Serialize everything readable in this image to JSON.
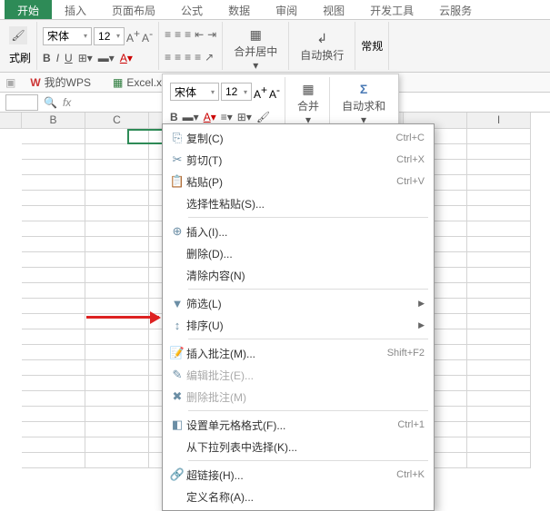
{
  "ribbonTabs": [
    "开始",
    "插入",
    "页面布局",
    "公式",
    "数据",
    "审阅",
    "视图",
    "开发工具",
    "云服务"
  ],
  "formatBrush": "式刷",
  "font": {
    "name": "宋体",
    "size": "12"
  },
  "merge": "合并居中",
  "wrap": "自动换行",
  "normal": "常规",
  "docTabs": {
    "wps": "我的WPS",
    "xls": "Excel.xls *"
  },
  "floatBar": {
    "font": "宋体",
    "size": "12",
    "merge": "合并",
    "sum": "自动求和"
  },
  "cols": [
    "B",
    "C",
    "",
    "",
    "",
    "",
    "",
    "I"
  ],
  "ctx": {
    "copy": {
      "l": "复制(C)",
      "s": "Ctrl+C"
    },
    "cut": {
      "l": "剪切(T)",
      "s": "Ctrl+X"
    },
    "paste": {
      "l": "粘贴(P)",
      "s": "Ctrl+V"
    },
    "pspec": "选择性粘贴(S)...",
    "insert": "插入(I)...",
    "delete": "删除(D)...",
    "clear": "清除内容(N)",
    "filter": "筛选(L)",
    "sort": "排序(U)",
    "comment": {
      "l": "插入批注(M)...",
      "s": "Shift+F2"
    },
    "editc": "编辑批注(E)...",
    "delc": "删除批注(M)",
    "format": {
      "l": "设置单元格格式(F)...",
      "s": "Ctrl+1"
    },
    "pick": "从下拉列表中选择(K)...",
    "link": {
      "l": "超链接(H)...",
      "s": "Ctrl+K"
    },
    "name": "定义名称(A)..."
  }
}
